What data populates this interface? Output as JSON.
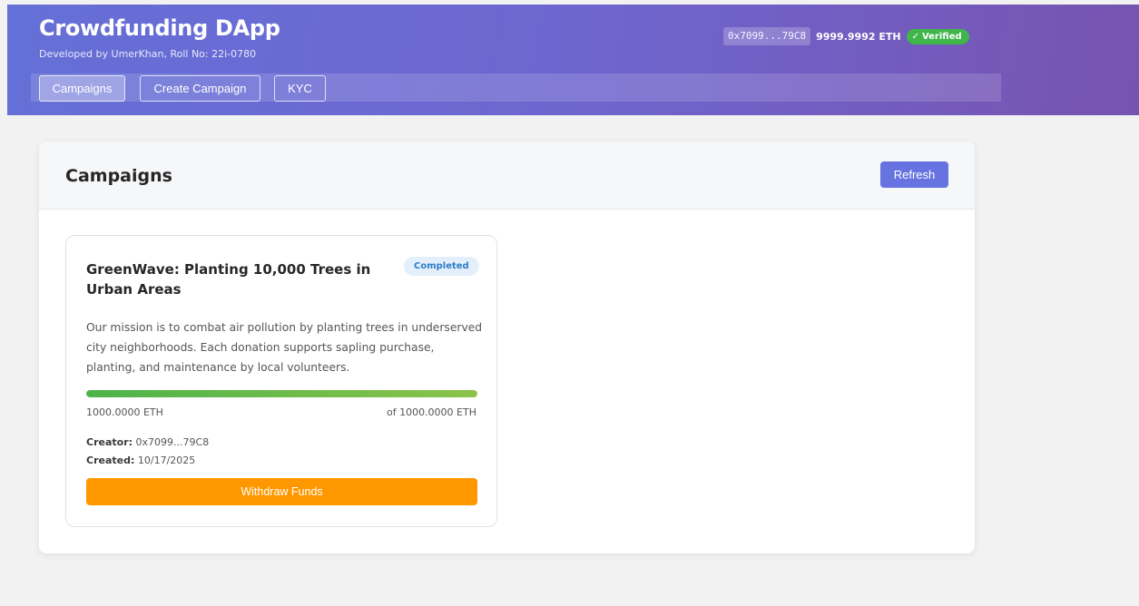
{
  "header": {
    "title": "Crowdfunding DApp",
    "subtitle": "Developed by UmerKhan, Roll No: 22i-0780",
    "wallet": {
      "address": "0x7099...79C8",
      "balance": "9999.9992 ETH",
      "verified_label": "Verified",
      "verified_icon": "check-icon"
    },
    "nav": [
      {
        "label": "Campaigns",
        "active": true
      },
      {
        "label": "Create Campaign",
        "active": false
      },
      {
        "label": "KYC",
        "active": false
      }
    ]
  },
  "campaigns_panel": {
    "title": "Campaigns",
    "refresh_label": "Refresh",
    "cards": [
      {
        "title": "GreenWave: Planting 10,000 Trees in Urban Areas",
        "status": "Completed",
        "description": "Our mission is to combat air pollution by planting trees in underserved city neighborhoods. Each donation supports sapling purchase, planting, and maintenance by local volunteers.",
        "raised": "1000.0000 ETH",
        "goal": "of 1000.0000 ETH",
        "progress_percent": 100,
        "creator_label": "Creator:",
        "creator_value": " 0x7099...79C8",
        "created_label": "Created:",
        "created_value": " 10/17/2025",
        "action_label": "Withdraw Funds"
      }
    ]
  },
  "colors": {
    "header_gradient_start": "#6470d7",
    "header_gradient_end": "#7753b0",
    "verified": "#3fb54a",
    "refresh": "#6673e0",
    "withdraw": "#ff9800",
    "progress": "#4db34b",
    "badge_bg": "#e3f0fb",
    "badge_text": "#2f7cc7"
  }
}
